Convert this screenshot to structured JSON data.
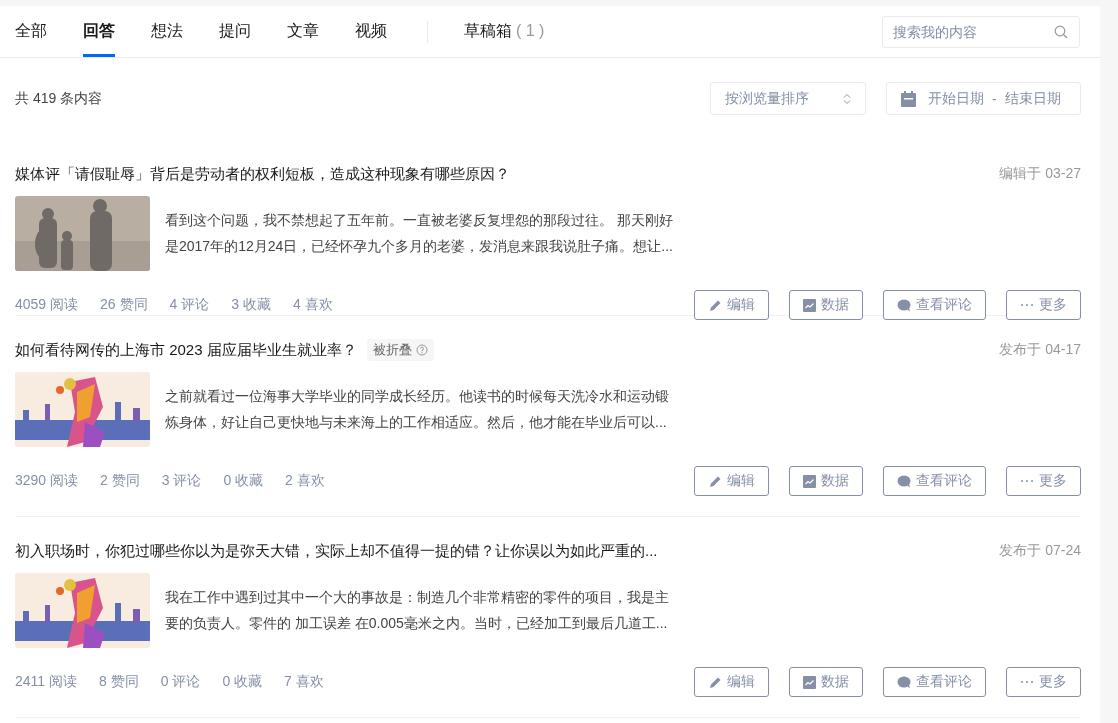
{
  "tabs": [
    {
      "label": "全部",
      "selected": false
    },
    {
      "label": "回答",
      "selected": true
    },
    {
      "label": "想法",
      "selected": false
    },
    {
      "label": "提问",
      "selected": false
    },
    {
      "label": "文章",
      "selected": false
    },
    {
      "label": "视频",
      "selected": false
    }
  ],
  "drafts": {
    "label": "草稿箱",
    "count": "( 1 )"
  },
  "search": {
    "placeholder": "搜索我的内容"
  },
  "total": "共 419 条内容",
  "sort": {
    "value": "按浏览量排序"
  },
  "date_range": {
    "start": "开始日期",
    "separator": "-",
    "end": "结束日期"
  },
  "items": [
    {
      "title": "媒体评「请假耻辱」背后是劳动者的权利短板，造成这种现象有哪些原因？",
      "folded": false,
      "date": "编辑于 03-27",
      "excerpt": [
        "看到这个问题，我不禁想起了五年前。一直被老婆反复埋怨的那段过往。 那天刚好",
        "是2017年的12月24日，已经怀孕九个多月的老婆，发消息来跟我说肚子痛。想让..."
      ],
      "stats": [
        "4059 阅读",
        "26 赞同",
        "4 评论",
        "3 收藏",
        "4 喜欢"
      ],
      "actions": [
        {
          "kind": "edit",
          "label": "编辑"
        },
        {
          "kind": "data",
          "label": "数据"
        },
        {
          "kind": "comments",
          "label": "查看评论"
        },
        {
          "kind": "more",
          "label": "更多"
        }
      ]
    },
    {
      "title": "如何看待网传的上海市 2023 届应届毕业生就业率？",
      "folded": true,
      "folded_label": "被折叠",
      "date": "发布于 04-17",
      "excerpt": [
        "之前就看过一位海事大学毕业的同学成长经历。他读书的时候每天洗冷水和运动锻",
        "炼身体，好让自己更快地与未来海上的工作相适应。然后，他才能在毕业后可以..."
      ],
      "stats": [
        "3290 阅读",
        "2 赞同",
        "3 评论",
        "0 收藏",
        "2 喜欢"
      ],
      "actions": [
        {
          "kind": "edit",
          "label": "编辑"
        },
        {
          "kind": "data",
          "label": "数据"
        },
        {
          "kind": "comments",
          "label": "查看评论"
        },
        {
          "kind": "more",
          "label": "更多"
        }
      ]
    },
    {
      "title": "初入职场时，你犯过哪些你以为是弥天大错，实际上却不值得一提的错？让你误以为如此严重的...",
      "folded": false,
      "date": "发布于 07-24",
      "excerpt": [
        "我在工作中遇到过其中一个大的事故是：制造几个非常精密的零件的项目，我是主",
        "要的负责人。零件的 加工误差 在0.005毫米之内。当时，已经加工到最后几道工..."
      ],
      "stats": [
        "2411 阅读",
        "8 赞同",
        "0 评论",
        "0 收藏",
        "7 喜欢"
      ],
      "actions": [
        {
          "kind": "edit",
          "label": "编辑"
        },
        {
          "kind": "data",
          "label": "数据"
        },
        {
          "kind": "comments",
          "label": "查看评论"
        },
        {
          "kind": "more",
          "label": "更多"
        }
      ]
    }
  ]
}
